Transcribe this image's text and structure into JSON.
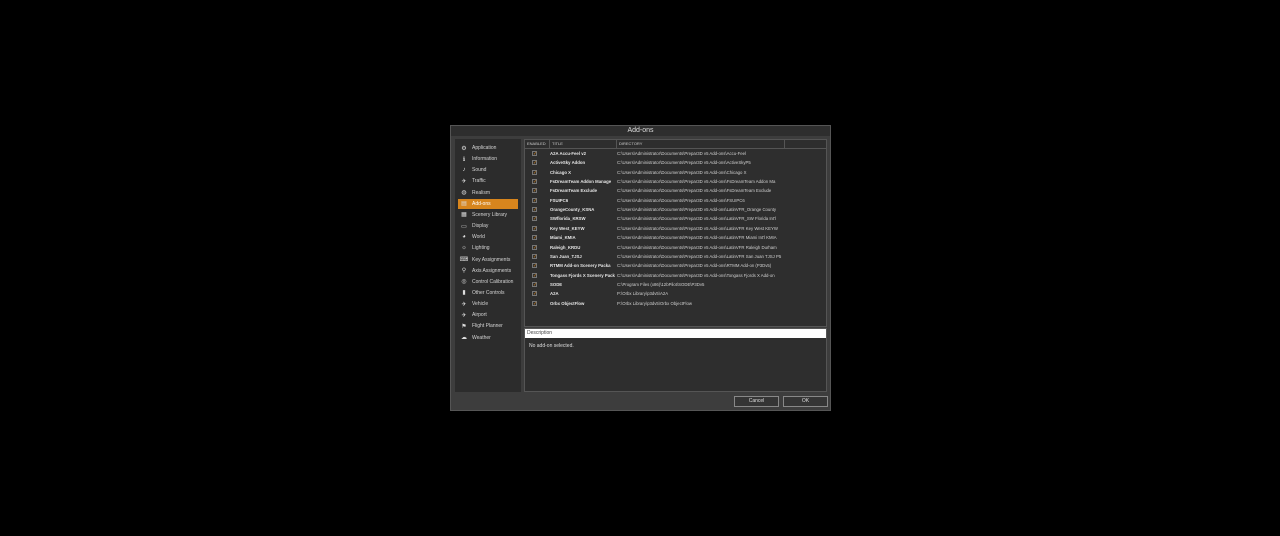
{
  "dialog": {
    "title": "Add-ons"
  },
  "sidebar": {
    "items": [
      {
        "label": "Application",
        "icon": "gears-icon"
      },
      {
        "label": "Information",
        "icon": "info-icon"
      },
      {
        "label": "Sound",
        "icon": "speaker-icon"
      },
      {
        "label": "Traffic",
        "icon": "traffic-icon"
      },
      {
        "label": "Realism",
        "icon": "globe-icon"
      },
      {
        "label": "Add-ons",
        "icon": "addons-icon",
        "selected": true
      },
      {
        "label": "Scenery Library",
        "icon": "library-icon"
      },
      {
        "label": "Display",
        "icon": "monitor-icon"
      },
      {
        "label": "World",
        "icon": "world-icon"
      },
      {
        "label": "Lighting",
        "icon": "lighting-icon"
      },
      {
        "label": "Key Assignments",
        "icon": "keyboard-icon"
      },
      {
        "label": "Axis Assignments",
        "icon": "joystick-icon"
      },
      {
        "label": "Control Calibration",
        "icon": "calibration-icon"
      },
      {
        "label": "Other Controls",
        "icon": "controls-icon"
      },
      {
        "label": "Vehicle",
        "icon": "plane-icon"
      },
      {
        "label": "Airport",
        "icon": "airport-icon"
      },
      {
        "label": "Flight Planner",
        "icon": "flight-planner-icon"
      },
      {
        "label": "Weather",
        "icon": "weather-icon"
      }
    ]
  },
  "table": {
    "headers": {
      "enabled": "ENABLED",
      "title": "TITLE",
      "directory": "DIRECTORY"
    },
    "rows": [
      {
        "title": "A2A Accu-Feel v2",
        "directory": "C:\\Users\\Administrator\\Documents\\Prepar3D v5 Add-ons\\Accu-Feel",
        "enabled": true
      },
      {
        "title": "ActiveSky Addon",
        "directory": "C:\\Users\\Administrator\\Documents\\Prepar3D v5 Add-ons\\ActiveSkyP5",
        "enabled": true
      },
      {
        "title": "Chicago X",
        "directory": "C:\\Users\\Administrator\\Documents\\Prepar3D v5 Add-ons\\Chicago X",
        "enabled": true
      },
      {
        "title": "FsDreamTeam Addon Manage",
        "directory": "C:\\Users\\Administrator\\Documents\\Prepar3D v5 Add-ons\\FsDreamTeam Addon Ma",
        "enabled": true
      },
      {
        "title": "FsDreamTeam Exclude",
        "directory": "C:\\Users\\Administrator\\Documents\\Prepar3D v5 Add-ons\\FsDreamTeam Exclude",
        "enabled": true
      },
      {
        "title": "FSUIPC6",
        "directory": "C:\\Users\\Administrator\\Documents\\Prepar3D v5 Add-ons\\FSUIPC6",
        "enabled": true
      },
      {
        "title": "OrangeCounty_KSNA",
        "directory": "C:\\Users\\Administrator\\Documents\\Prepar3D v5 Add-ons\\LatinVFR_Orange County",
        "enabled": true
      },
      {
        "title": "SWflorida_KRSW",
        "directory": "C:\\Users\\Administrator\\Documents\\Prepar3D v5 Add-ons\\LatinVFR_SW Florida Int'l",
        "enabled": true
      },
      {
        "title": "Key West_KEYW",
        "directory": "C:\\Users\\Administrator\\Documents\\Prepar3D v5 Add-ons\\LatinVFR Key West KEYW",
        "enabled": true
      },
      {
        "title": "Miami_KMIA",
        "directory": "C:\\Users\\Administrator\\Documents\\Prepar3D v5 Add-ons\\LatinVFR Miami Int'l KMIA",
        "enabled": true
      },
      {
        "title": "Raleigh_KRDU",
        "directory": "C:\\Users\\Administrator\\Documents\\Prepar3D v5 Add-ons\\LatinVFR Raleigh Durham",
        "enabled": true
      },
      {
        "title": "San Juan_TJSJ",
        "directory": "C:\\Users\\Administrator\\Documents\\Prepar3D v5 Add-ons\\LatinVFR San Juan TJSJ P5",
        "enabled": true
      },
      {
        "title": "RTMM Add-on Scenery Packa",
        "directory": "C:\\Users\\Administrator\\Documents\\Prepar3D v5 Add-ons\\RTMM Add-on (P3Dv5)",
        "enabled": true
      },
      {
        "title": "Tongass Fjords X Scenery Pack",
        "directory": "C:\\Users\\Administrator\\Documents\\Prepar3D v5 Add-ons\\Tongass Fjords X Add-on",
        "enabled": true
      },
      {
        "title": "SODE",
        "directory": "C:\\Program Files (x86)\\12bPilot\\SODE\\P3Dv5",
        "enabled": true
      },
      {
        "title": "A2A",
        "directory": "P:\\Orbx Library\\p3dv5\\A2A",
        "enabled": true
      },
      {
        "title": "Orbx ObjectFlow",
        "directory": "P:\\Orbx Library\\p3dv5\\Orbx ObjectFlow",
        "enabled": true
      }
    ]
  },
  "description": {
    "header": "Description",
    "text": "No add-on selected."
  },
  "buttons": {
    "cancel": "Cancel",
    "ok": "OK"
  },
  "colors": {
    "accent": "#d7851d",
    "background": "#3d3d3d",
    "panel": "#2e2e2e"
  }
}
